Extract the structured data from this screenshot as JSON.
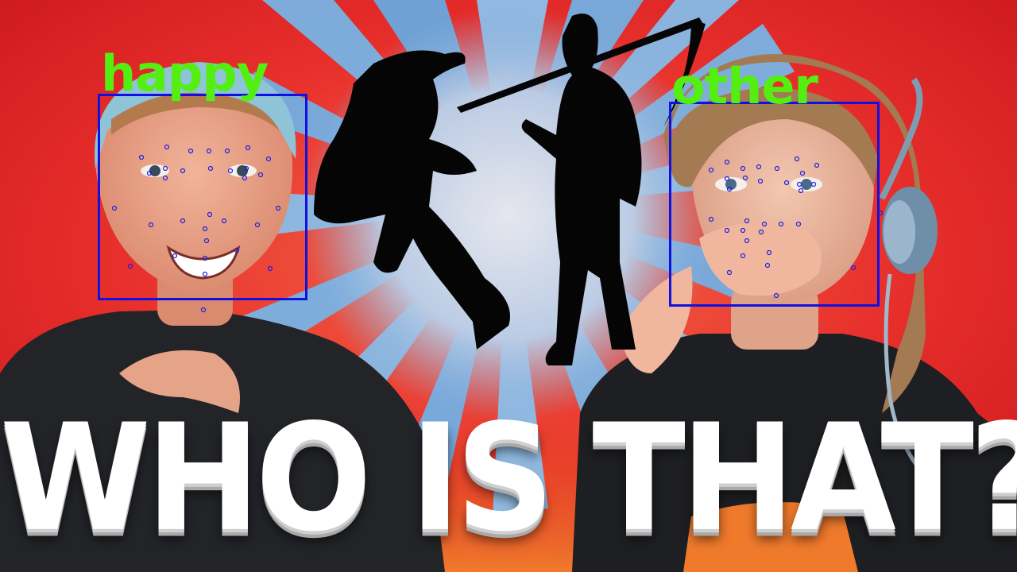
{
  "thumbnail": {
    "headline": "WHO IS THAT?"
  },
  "detections": [
    {
      "emotion": "happy",
      "color": "#55ee11"
    },
    {
      "emotion": "other",
      "color": "#55ee11"
    }
  ],
  "colors": {
    "background_red": "#e8252a",
    "burst_blue": "#7fb6e6",
    "box_blue": "#1010e0",
    "label_green": "#55ee11",
    "headline_white": "#ffffff"
  }
}
